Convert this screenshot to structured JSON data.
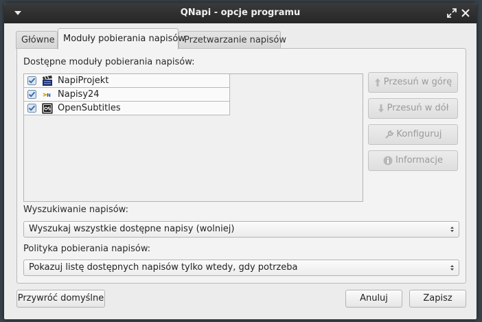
{
  "window": {
    "title": "QNapi - opcje programu"
  },
  "tabs": [
    {
      "label": "Główne",
      "active": false
    },
    {
      "label": "Moduły pobierania napisów",
      "active": true
    },
    {
      "label": "Przetwarzanie napisów",
      "active": false
    }
  ],
  "modules": {
    "label": "Dostępne moduły pobierania napisów:",
    "items": [
      {
        "name": "NapiProjekt",
        "checked": true,
        "icon": "clapperboard-icon"
      },
      {
        "name": "Napisy24",
        "checked": true,
        "icon": "napisy24-icon"
      },
      {
        "name": "OpenSubtitles",
        "checked": true,
        "icon": "opensubtitles-icon"
      }
    ]
  },
  "side_buttons": {
    "move_up": "Przesuń w górę",
    "move_down": "Przesuń w dół",
    "configure": "Konfiguruj",
    "info": "Informacje"
  },
  "search": {
    "label": "Wyszukiwanie napisów:",
    "value": "Wyszukaj wszystkie dostępne napisy (wolniej)"
  },
  "policy": {
    "label": "Polityka pobierania napisów:",
    "value": "Pokazuj listę dostępnych napisów tylko wtedy, gdy potrzeba"
  },
  "footer": {
    "restore_defaults": "Przywróć domyślne",
    "cancel": "Anuluj",
    "save": "Zapisz"
  },
  "colors": {
    "titlebar": "#2e2e2e",
    "window_bg": "#ececec",
    "check_accent": "#4a7ab0"
  }
}
